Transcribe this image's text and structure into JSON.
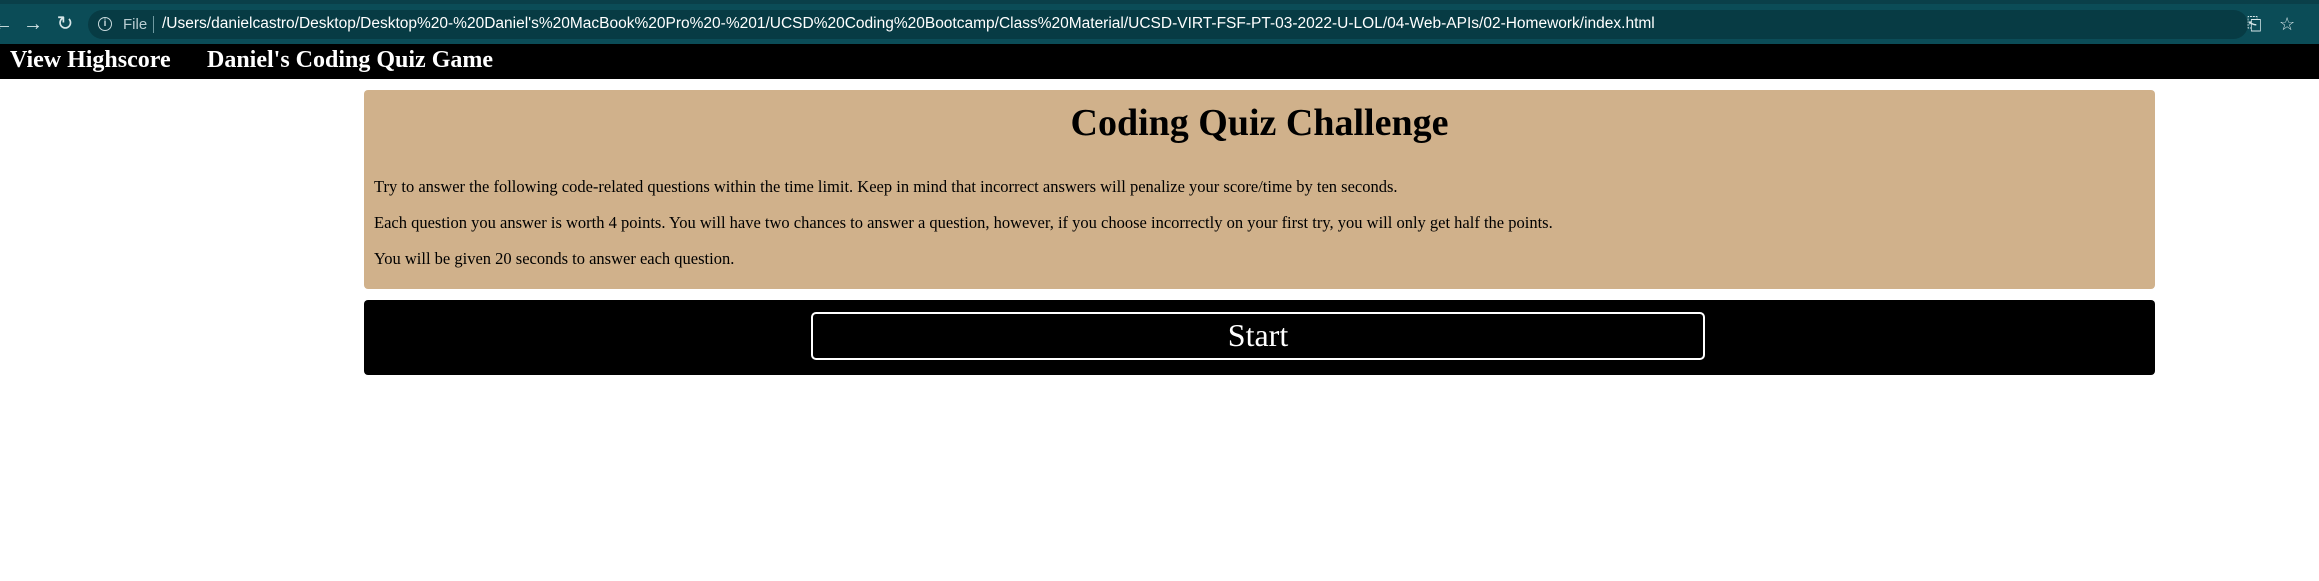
{
  "browser": {
    "back_icon": "←",
    "forward_icon": "→",
    "reload_icon": "↻",
    "info_icon": "i",
    "scheme_label": "File",
    "url": "/Users/danielcastro/Desktop/Desktop%20-%20Daniel's%20MacBook%20Pro%20-%201/UCSD%20Coding%20Bootcamp/Class%20Material/UCSD-VIRT-FSF-PT-03-2022-U-LOL/04-Web-APIs/02-Homework/index.html",
    "share_icon": "⎗",
    "bookmark_icon": "☆"
  },
  "site_nav": {
    "highscore_link": "View Highscore",
    "site_title": "Daniel's Coding Quiz Game"
  },
  "intro": {
    "title": "Coding Quiz Challenge",
    "paragraphs": [
      "Try to answer the following code-related questions within the time limit. Keep in mind that incorrect answers will penalize your score/time by ten seconds.",
      "Each question you answer is worth 4 points. You will have two chances to answer a question, however, if you choose incorrectly on your first try, you will only get half the points.",
      "You will be given 20 seconds to answer each question."
    ]
  },
  "start": {
    "button_label": "Start"
  }
}
